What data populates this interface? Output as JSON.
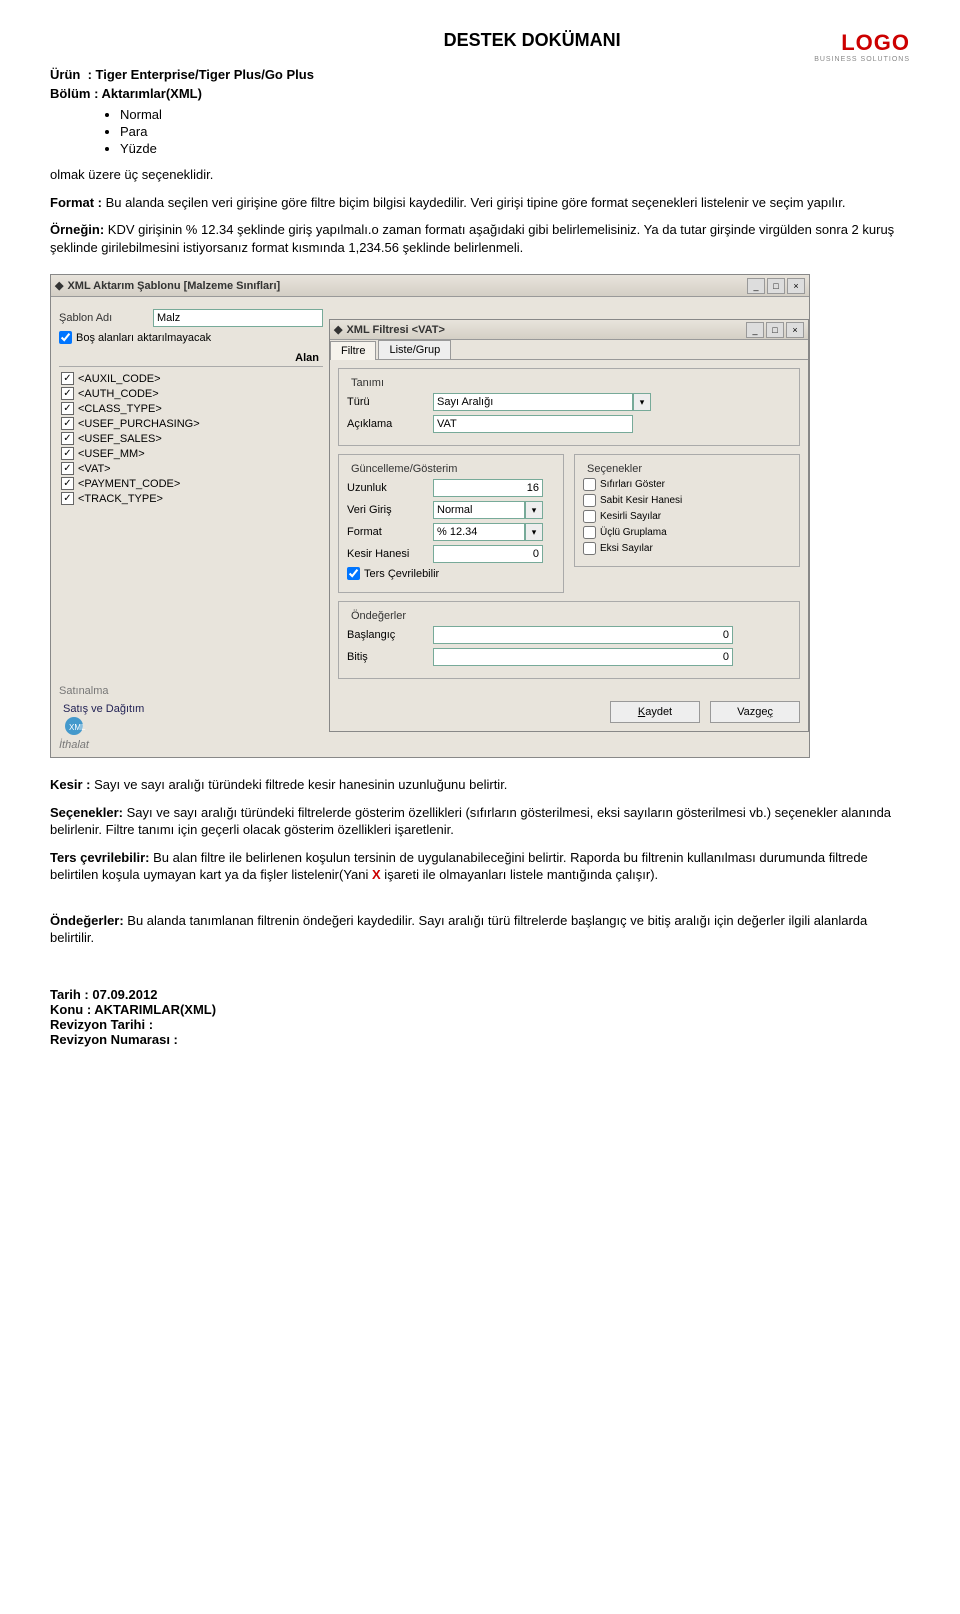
{
  "doc": {
    "title": "DESTEK DOKÜMANI",
    "urun_label": "Ürün",
    "urun_value": ": Tiger Enterprise/Tiger Plus/Go Plus",
    "bolum_label": "Bölüm",
    "bolum_value": ": Aktarımlar(XML)",
    "logo_text": "LOGO",
    "logo_sub": "BUSINESS SOLUTIONS"
  },
  "bullets": [
    "Normal",
    "Para",
    "Yüzde"
  ],
  "after_bullets": "olmak üzere üç seçeneklidir.",
  "para_format": {
    "label": "Format :",
    "text": " Bu alanda seçilen veri girişine göre filtre biçim bilgisi kaydedilir. Veri girişi tipine göre format seçenekleri listelenir ve seçim yapılır."
  },
  "para_ornek": {
    "label": "Örneğin:",
    "text": " KDV girişinin % 12.34 şeklinde giriş yapılmalı.o zaman formatı aşağıdaki gibi belirlemelisiniz. Ya da tutar girşinde virgülden sonra 2 kuruş şeklinde girilebilmesini istiyorsanız format kısmında 1,234.56 şeklinde belirlenmeli."
  },
  "para_kesir": {
    "label": "Kesir :",
    "text": " Sayı ve sayı aralığı türündeki filtrede kesir hanesinin uzunluğunu belirtir."
  },
  "para_secenekler": {
    "label": "Seçenekler:",
    "text": " Sayı ve sayı aralığı türündeki filtrelerde gösterim özellikleri (sıfırların gösterilmesi, eksi sayıların gösterilmesi vb.) seçenekler alanında belirlenir. Filtre tanımı için geçerli olacak gösterim özellikleri işaretlenir."
  },
  "para_ters": {
    "label": "Ters çevrilebilir:",
    "text": " Bu alan filtre ile belirlenen koşulun tersinin de uygulanabileceğini belirtir. Raporda bu filtrenin kullanılması durumunda filtrede belirtilen koşula uymayan kart ya da fişler listelenir(Yani ",
    "red": "X",
    "tail": " işareti ile olmayanları listele mantığında çalışır)."
  },
  "para_ondeger": {
    "label": "Öndeğerler:",
    "text": " Bu alanda tanımlanan filtrenin öndeğeri kaydedilir. Sayı aralığı türü filtrelerde başlangıç ve bitiş aralığı için değerler ilgili alanlarda belirtilir."
  },
  "footer": {
    "lines": [
      {
        "label": "Tarih : ",
        "value": "07.09.2012"
      },
      {
        "label": "Konu : ",
        "value": "AKTARIMLAR(XML)"
      },
      {
        "label": "Revizyon Tarihi :",
        "value": ""
      },
      {
        "label": "Revizyon Numarası :",
        "value": ""
      }
    ]
  },
  "win_outer": {
    "title": "XML Aktarım Şablonu [Malzeme Sınıfları]",
    "sablon_adi_label": "Şablon Adı",
    "sablon_adi_value": "Malz",
    "bos_alanlar": "Boş alanları aktarılmayacak",
    "alan_header": "Alan",
    "fields": [
      "<AUXIL_CODE>",
      "<AUTH_CODE>",
      "<CLASS_TYPE>",
      "<USEF_PURCHASING>",
      "<USEF_SALES>",
      "<USEF_MM>",
      "<VAT>",
      "<PAYMENT_CODE>",
      "<TRACK_TYPE>"
    ],
    "bottom_items": [
      "Satınalma",
      "Satış ve Dağıtım",
      "İthalat"
    ],
    "xml_badge": "XML"
  },
  "win_inner": {
    "title": "XML Filtresi <VAT>",
    "tabs": [
      "Filtre",
      "Liste/Grup"
    ],
    "tanimi_group": "Tanımı",
    "turu_label": "Türü",
    "turu_value": "Sayı Aralığı",
    "aciklama_label": "Açıklama",
    "aciklama_value": "VAT",
    "guncelleme_group": "Güncelleme/Gösterim",
    "uzunluk_label": "Uzunluk",
    "uzunluk_value": "16",
    "veri_giris_label": "Veri Giriş",
    "veri_giris_value": "Normal",
    "format_label": "Format",
    "format_value": "% 12.34",
    "kesir_label": "Kesir Hanesi",
    "kesir_value": "0",
    "ters_label": "Ters Çevrilebilir",
    "secenekler_group": "Seçenekler",
    "secenekler_opts": [
      "Sıfırları Göster",
      "Sabit Kesir Hanesi",
      "Kesirli Sayılar",
      "Üçlü Gruplama",
      "Eksi Sayılar"
    ],
    "ondeger_group": "Öndeğerler",
    "baslangic_label": "Başlangıç",
    "baslangic_value": "0",
    "bitis_label": "Bitiş",
    "bitis_value": "0",
    "kaydet": "Kaydet",
    "vazgec": "Vazgeç"
  }
}
